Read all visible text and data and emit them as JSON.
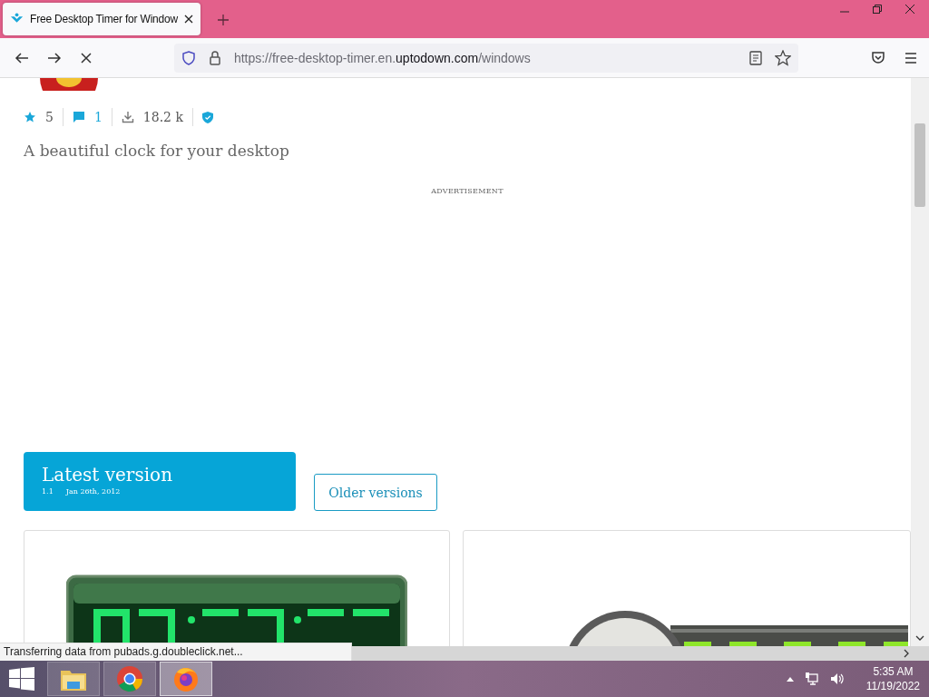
{
  "browser": {
    "tabs": [
      {
        "title": "Free Desktop Timer for Window",
        "selected": true
      }
    ],
    "url": {
      "prefix": "https://free-desktop-timer.en.",
      "domain": "uptodown.com",
      "path": "/windows"
    },
    "loading": true
  },
  "app": {
    "stats": [
      {
        "kind": "rating",
        "value": "5"
      },
      {
        "kind": "comments",
        "value": "1"
      },
      {
        "kind": "downloads",
        "value": "18.2 k"
      },
      {
        "kind": "verified"
      }
    ],
    "tagline": "A beautiful clock for your desktop",
    "ad_label": "ADVERTISEMENT",
    "latest": {
      "title": "Latest version",
      "version": "1.1",
      "date": "Jan 26th, 2012"
    },
    "older_button": "Older versions"
  },
  "status_bar": "Transferring data from pubads.g.doubleclick.net...",
  "taskbar": {
    "apps": [
      {
        "kind": "explorer",
        "selected": false
      },
      {
        "kind": "chrome",
        "selected": false
      },
      {
        "kind": "firefox",
        "selected": true
      }
    ],
    "time": "5:35 AM",
    "date": "11/19/2022"
  }
}
